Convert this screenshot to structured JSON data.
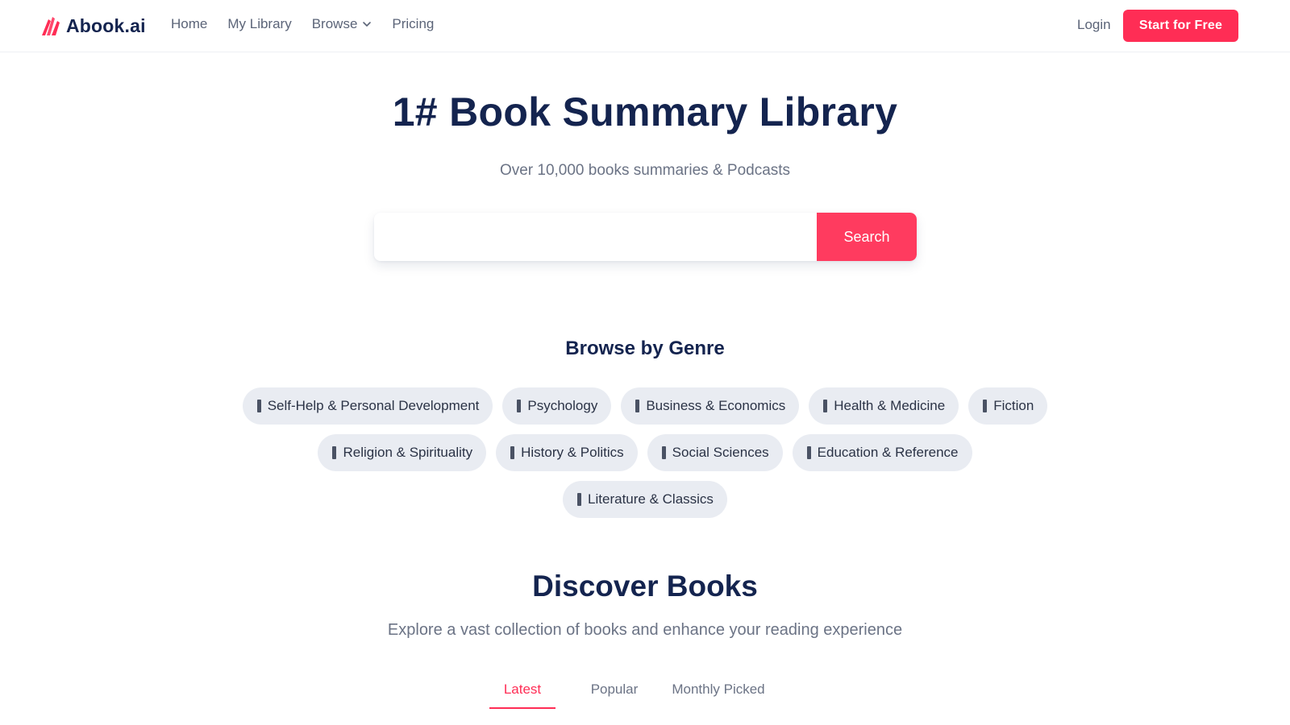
{
  "brand": {
    "name": "Abook.ai",
    "accent": "#ff2d55",
    "navy": "#14244f"
  },
  "nav": {
    "links": [
      {
        "label": "Home"
      },
      {
        "label": "My Library"
      },
      {
        "label": "Browse",
        "icon": "chevron-down-icon"
      },
      {
        "label": "Pricing"
      }
    ],
    "login": "Login",
    "cta": "Start for Free"
  },
  "hero": {
    "title": "1# Book Summary Library",
    "subtitle": "Over 10,000 books summaries & Podcasts",
    "search_value": "",
    "search_button": "Search"
  },
  "genres": {
    "title": "Browse by Genre",
    "rows": [
      [
        "Self-Help & Personal Development",
        "Psychology",
        "Business & Economics",
        "Health & Medicine",
        "Fiction"
      ],
      [
        "Religion & Spirituality",
        "History & Politics",
        "Social Sciences",
        "Education & Reference"
      ],
      [
        "Literature & Classics"
      ]
    ]
  },
  "discover": {
    "title": "Discover Books",
    "subtitle": "Explore a vast collection of books and enhance your reading experience",
    "tabs": [
      {
        "label": "Latest",
        "active": true
      },
      {
        "label": "Popular",
        "active": false
      },
      {
        "label": "Monthly Picked",
        "active": false
      }
    ]
  }
}
